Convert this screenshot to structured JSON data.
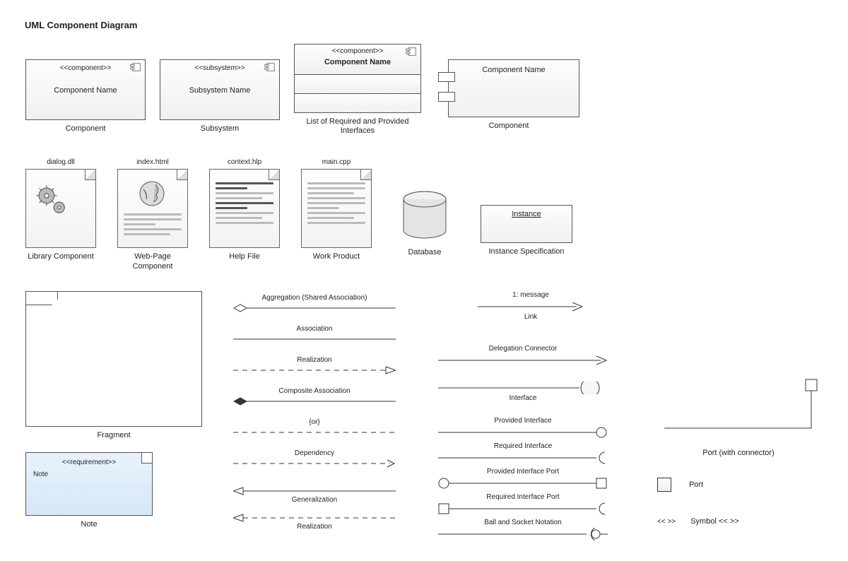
{
  "title": "UML Component Diagram",
  "row1": {
    "component": {
      "stereo": "<<component>>",
      "name": "Component Name",
      "label": "Component"
    },
    "subsystem": {
      "stereo": "<<subsystem>>",
      "name": "Subsystem Name",
      "label": "Subsystem"
    },
    "interfaces": {
      "stereo": "<<component>>",
      "name": "Component Name",
      "label": "List of Required and Provided Interfaces"
    },
    "component2": {
      "name": "Component Name",
      "label": "Component"
    }
  },
  "row2": {
    "library": {
      "file": "dialog.dll",
      "label": "Library Component"
    },
    "webpage": {
      "file": "index.html",
      "label": "Web-Page Component"
    },
    "help": {
      "file": "context.hlp",
      "label": "Help File"
    },
    "work": {
      "file": "main.cpp",
      "label": "Work Product"
    },
    "database": {
      "label": "Database"
    },
    "instance": {
      "name": "Instance",
      "label": "Instance Specification"
    }
  },
  "fragment": {
    "label": "Fragment"
  },
  "noteBox": {
    "stereo": "<<requirement>>",
    "text": "Note",
    "label": "Note"
  },
  "relLeft": {
    "aggregation": "Aggregation (Shared Association)",
    "association": "Association",
    "realization1": "Realization",
    "composite": "Composite Association",
    "or": "{or}",
    "dependency": "Dependency",
    "generalization": "Generalization",
    "realization2": "Realization"
  },
  "relRight": {
    "link_msg": "1: message",
    "link": "Link",
    "delegation": "Delegation Connector",
    "interface": "Interface",
    "provided": "Provided Interface",
    "required": "Required Interface",
    "provPort": "Provided Interface Port",
    "reqPort": "Required Interface Port",
    "ballSocket": "Ball and Socket Notation"
  },
  "portCol": {
    "portConn": "Port (with connector)",
    "port": "Port",
    "symPre": "<<  >>",
    "symbol": "Symbol << >>"
  }
}
